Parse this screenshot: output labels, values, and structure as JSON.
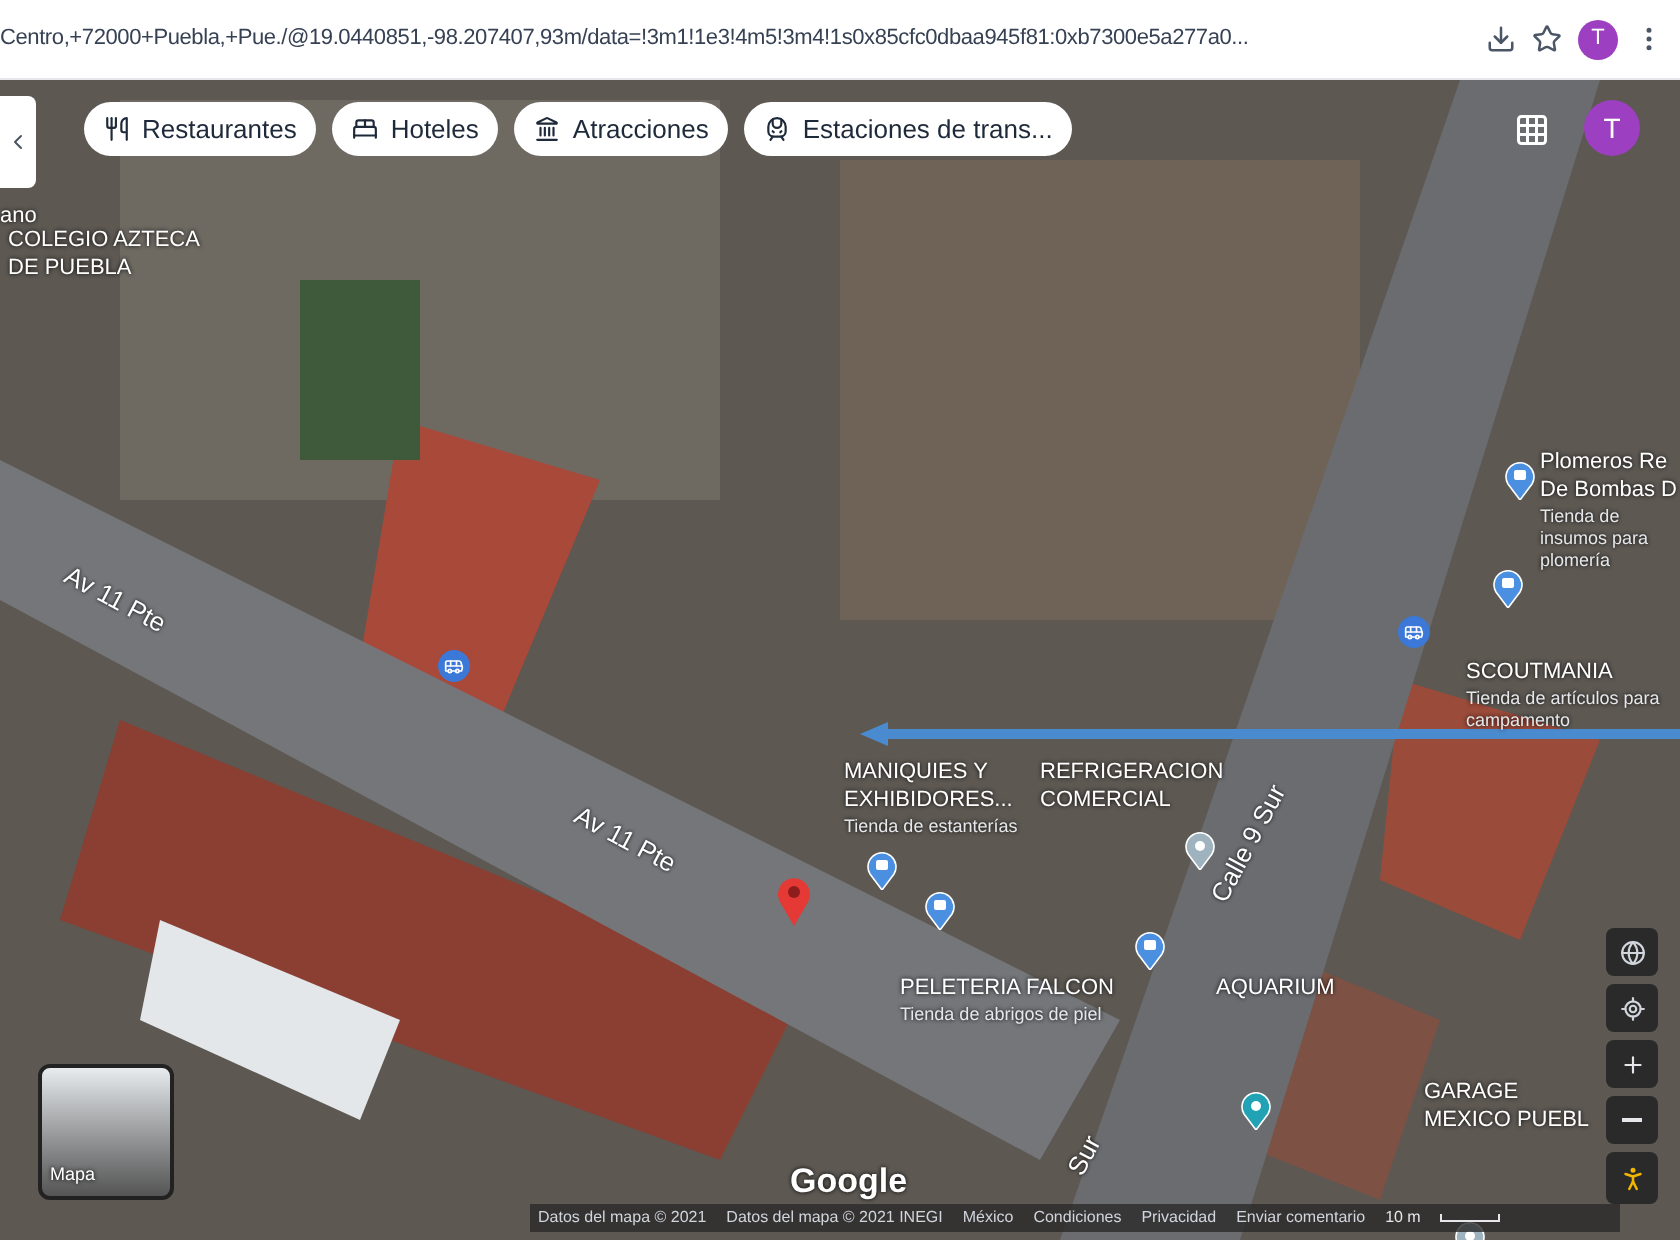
{
  "browser": {
    "url": "Centro,+72000+Puebla,+Pue./@19.0440851,-98.207407,93m/data=!3m1!1e3!4m5!3m4!1s0x85cfc0dbaa945f81:0xb7300e5a277a0...",
    "profile_initial": "T"
  },
  "map": {
    "categories": [
      {
        "label": "Restaurantes",
        "kind": "restaurant"
      },
      {
        "label": "Hoteles",
        "kind": "hotel"
      },
      {
        "label": "Atracciones",
        "kind": "attraction"
      },
      {
        "label": "Estaciones de trans...",
        "kind": "transit"
      }
    ],
    "account_initial": "T",
    "places": [
      {
        "name": "ano"
      },
      {
        "name": "COLEGIO AZTECA DE PUEBLA"
      },
      {
        "name": "Plomeros Re De Bombas D",
        "subtitle": "Tienda de insumos para plomería"
      },
      {
        "name": "SCOUTMANIA",
        "subtitle": "Tienda de artículos para campamento"
      },
      {
        "name": "MANIQUIES Y EXHIBIDORES...",
        "subtitle": "Tienda de estanterías"
      },
      {
        "name": "REFRIGERACION COMERCIAL"
      },
      {
        "name": "PELETERIA FALCON",
        "subtitle": "Tienda de abrigos de piel"
      },
      {
        "name": "AQUARIUM"
      },
      {
        "name": "GARAGE MEXICO PUEBL"
      }
    ],
    "streets": [
      {
        "name": "Av 11 Pte"
      },
      {
        "name": "Av 11 Pte"
      },
      {
        "name": "Calle 9 Sur"
      },
      {
        "name": "Sur"
      }
    ],
    "layer_toggle": "Mapa",
    "brand": "Google",
    "footer": [
      "Datos del mapa © 2021",
      "Datos del mapa © 2021 INEGI",
      "México",
      "Condiciones",
      "Privacidad",
      "Enviar comentario"
    ],
    "scale": "10 m"
  }
}
